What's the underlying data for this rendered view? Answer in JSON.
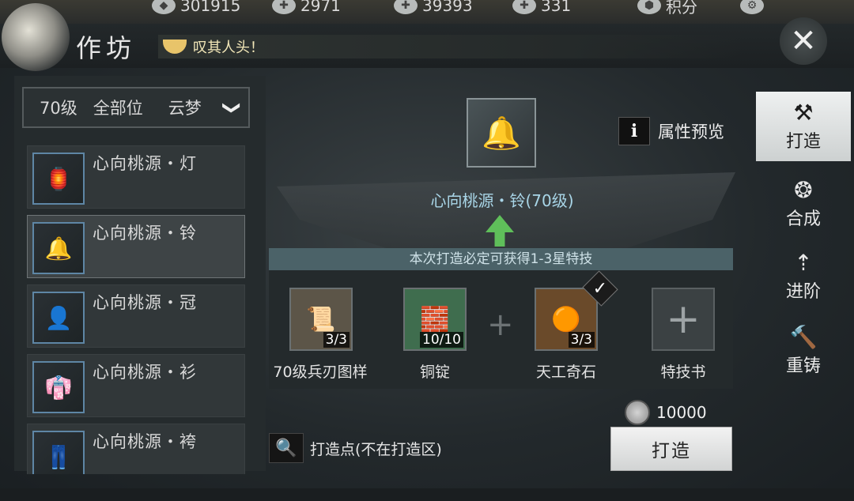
{
  "currencies": [
    {
      "icon": "gem-pouch-icon",
      "value": "301915"
    },
    {
      "icon": "silver-pile-icon",
      "value": "2971"
    },
    {
      "icon": "jade-icon",
      "value": "39393"
    },
    {
      "icon": "ingot-icon",
      "value": "331"
    },
    {
      "icon": "badge-icon",
      "value": "积分"
    }
  ],
  "header": {
    "title": "作坊",
    "slogan": "叹其人头！",
    "close_glyph": "✕"
  },
  "filter": {
    "level": "70级",
    "slot": "全部位",
    "school": "云梦",
    "chevron": "❯"
  },
  "item_list": [
    {
      "name": "心向桃源・灯",
      "icon": "lantern-weapon-icon"
    },
    {
      "name": "心向桃源・铃",
      "icon": "bell-hook-icon"
    },
    {
      "name": "心向桃源・冠",
      "icon": "crown-portrait-icon"
    },
    {
      "name": "心向桃源・衫",
      "icon": "robe-icon"
    },
    {
      "name": "心向桃源・袴",
      "icon": "trousers-icon"
    }
  ],
  "product": {
    "name": "心向桃源・铃(70级)",
    "icon": "bell-hook-icon"
  },
  "attr_preview": {
    "icon_glyph": "i",
    "label": "属性预览"
  },
  "banner": "本次打造必定可获得1-3星特技",
  "materials": [
    {
      "label": "70级兵刃图样",
      "count": "3/3",
      "icon": "blueprint-scroll-icon",
      "color": "#5c5548"
    },
    {
      "label": "铜锭",
      "count": "10/10",
      "icon": "copper-ingot-icon",
      "color": "#3f6d4e"
    },
    {
      "label": "天工奇石",
      "count": "3/3",
      "icon": "orb-stone-icon",
      "color": "#6a4a2a"
    }
  ],
  "skill_book": {
    "label": "特技书",
    "glyph": "+"
  },
  "plus_glyph": "+",
  "check_glyph": "✓",
  "cost": {
    "value": "10000"
  },
  "forge_point": {
    "label": "打造点(不在打造区)",
    "icon_glyph": "🔍"
  },
  "forge_button": "打造",
  "nav": [
    {
      "label": "打造",
      "glyph": "⚒",
      "active": true
    },
    {
      "label": "合成",
      "glyph": "❂",
      "active": false
    },
    {
      "label": "进阶",
      "glyph": "⇡",
      "active": false
    },
    {
      "label": "重铸",
      "glyph": "🔨",
      "active": false
    }
  ]
}
